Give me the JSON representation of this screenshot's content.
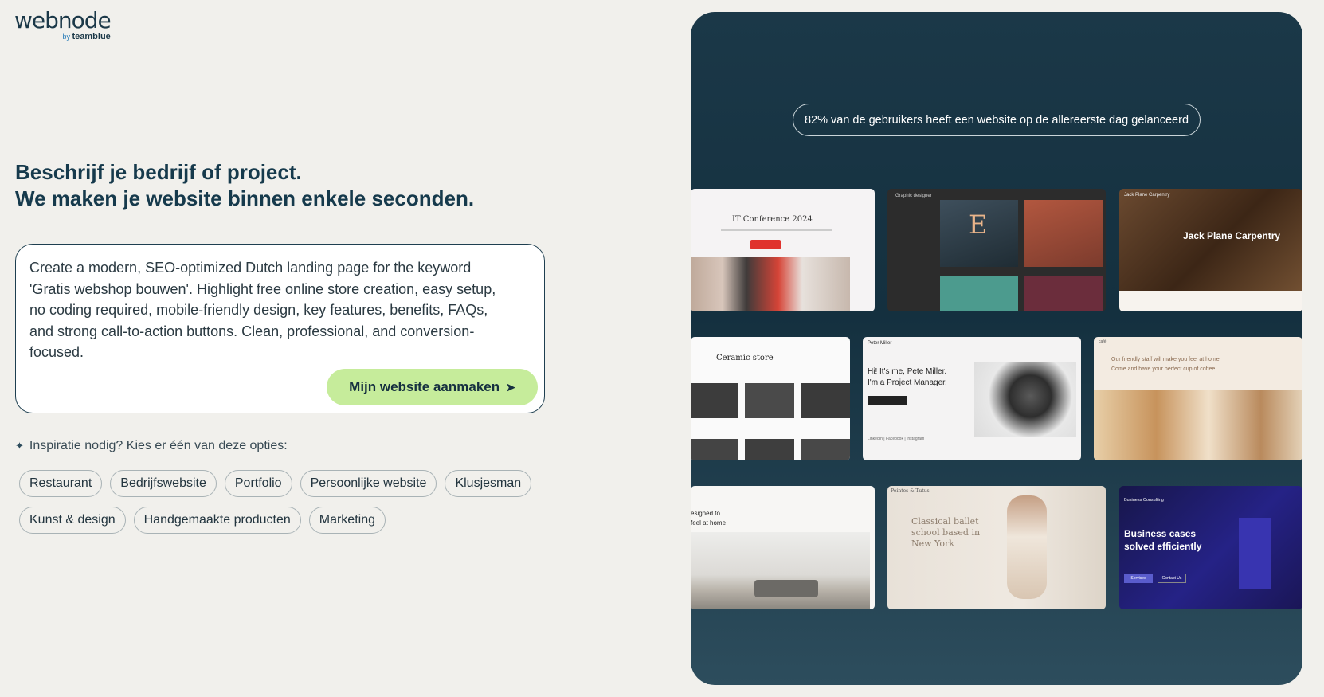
{
  "brand": {
    "name": "webnode",
    "by": "by",
    "parent": "teamblue"
  },
  "hero": {
    "line1": "Beschrijf je bedrijf of project.",
    "line2": "We maken je website binnen enkele seconden."
  },
  "prompt": {
    "value": "Create a modern, SEO-optimized Dutch landing page for the keyword 'Gratis webshop bouwen'. Highlight free online store creation, easy setup, no coding required, mobile-friendly design, key features, benefits, FAQs, and strong call-to-action buttons. Clean, professional, and conversion-focused.",
    "button_label": "Mijn website aanmaken",
    "button_icon": "arrow-right-icon",
    "button_color": "#c6ec9b"
  },
  "inspiration": {
    "label": "Inspiratie nodig? Kies er één van deze opties:",
    "icon": "sparkle-icon",
    "options": [
      "Restaurant",
      "Bedrijfswebsite",
      "Portfolio",
      "Persoonlijke website",
      "Klusjesman",
      "Kunst & design",
      "Handgemaakte producten",
      "Marketing"
    ]
  },
  "showcase": {
    "stat": "82% van de gebruikers heeft een website op de allereerste dag gelanceerd",
    "background": "#1b3848",
    "templates": {
      "conference": {
        "title": "IT Conference 2024",
        "accent": "#e0322d"
      },
      "designer": {
        "brand": "Graphic designer",
        "letter": "E"
      },
      "carpentry": {
        "brand": "Jack Plane Carpentry",
        "title": "Jack Plane Carpentry"
      },
      "ceramic": {
        "title": "Ceramic store"
      },
      "pete": {
        "brand": "Peter Miller",
        "line1": "Hi! It's me, Pete Miller.",
        "line2": "I'm a Project Manager.",
        "links": "LinkedIn | Facebook | Instagram"
      },
      "cafe": {
        "brand": "café",
        "line1": "Our friendly staff will make you feel at home.",
        "line2": "Come and have your perfect cup of coffee."
      },
      "interior": {
        "line1": "esigned to",
        "line2": "feel at home"
      },
      "ballet": {
        "brand": "Pointes & Tutus",
        "title": "Classical ballet school based in New York"
      },
      "business": {
        "brand": "Business Consulting",
        "title": "Business cases solved efficiently",
        "button1": "Services",
        "button2": "Contact Us"
      }
    }
  }
}
